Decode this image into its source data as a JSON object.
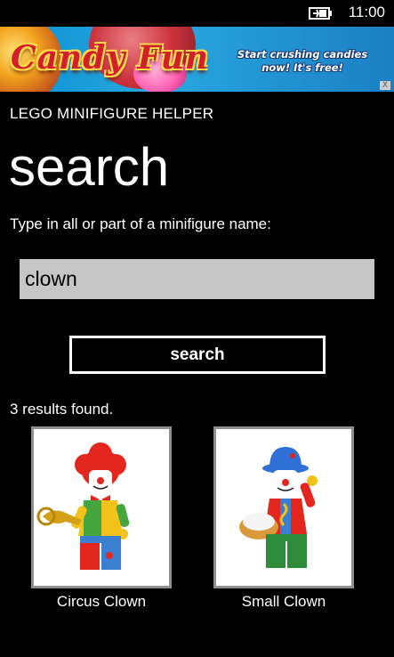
{
  "status_bar": {
    "time": "11:00",
    "icon": "battery-charging-icon"
  },
  "ad": {
    "logo": "Candy Fun",
    "tagline": "Start crushing candies now! It's free!",
    "close_label": "X",
    "colors": {
      "background": "#1b8fd0",
      "logo_text": "#d11f2b",
      "logo_outline": "#ffd84a"
    }
  },
  "app": {
    "title": "LEGO MINIFIGURE HELPER",
    "page_title": "search"
  },
  "search": {
    "instruction": "Type in all or part of a minifigure name:",
    "value": "clown",
    "button_label": "search"
  },
  "results": {
    "count_text": "3 results found.",
    "items": [
      {
        "name": "Circus Clown",
        "image": "circus-clown-minifigure"
      },
      {
        "name": "Small Clown",
        "image": "small-clown-minifigure"
      }
    ]
  },
  "colors": {
    "background": "#000000",
    "text": "#ffffff",
    "input_bg": "#c6c6c6",
    "frame_border": "#8f8f8f"
  }
}
